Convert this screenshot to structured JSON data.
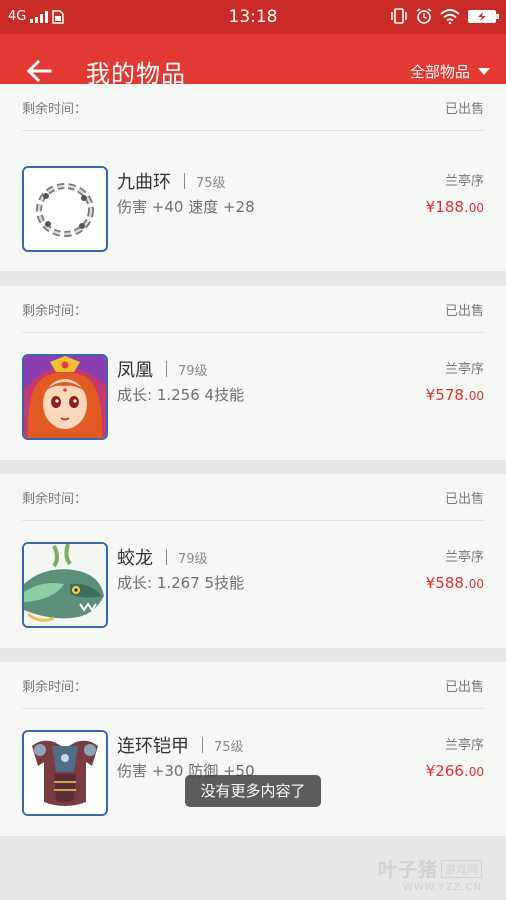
{
  "status_bar": {
    "network": "4G",
    "time": "13:18"
  },
  "app_bar": {
    "title": "我的物品",
    "filter_label": "全部物品",
    "back_icon": "arrow-left-icon",
    "filter_icon": "caret-down-icon"
  },
  "cards": [
    {
      "remaining_label": "剩余时间：",
      "status": "已出售",
      "name": "九曲环",
      "level": "75级",
      "stats": "伤害 +40 速度 +28",
      "seller": "兰亭序",
      "price_main": "¥188.",
      "price_cents": "00",
      "icon": "chain-ring-icon"
    },
    {
      "remaining_label": "剩余时间：",
      "status": "已出售",
      "name": "凤凰",
      "level": "79级",
      "stats": "成长: 1.256  4技能",
      "seller": "兰亭序",
      "price_main": "¥578.",
      "price_cents": "00",
      "icon": "phoenix-portrait-icon"
    },
    {
      "remaining_label": "剩余时间：",
      "status": "已出售",
      "name": "蛟龙",
      "level": "79级",
      "stats": "成长: 1.267  5技能",
      "seller": "兰亭序",
      "price_main": "¥588.",
      "price_cents": "00",
      "icon": "dragon-head-icon"
    },
    {
      "remaining_label": "剩余时间：",
      "status": "已出售",
      "name": "连环铠甲",
      "level": "75级",
      "stats": "伤害 +30 防御 +50",
      "seller": "兰亭序",
      "price_main": "¥266.",
      "price_cents": "00",
      "icon": "armor-icon"
    }
  ],
  "toast": "没有更多内容了",
  "watermark": {
    "brand": "叶子猪",
    "tag": "游戏网",
    "url": "WWW.YZZ.CN"
  },
  "colors": {
    "status_bar": "#c92b27",
    "app_bar": "#e23a33",
    "price": "#e03030",
    "thumb_border": "#3b67b1"
  }
}
